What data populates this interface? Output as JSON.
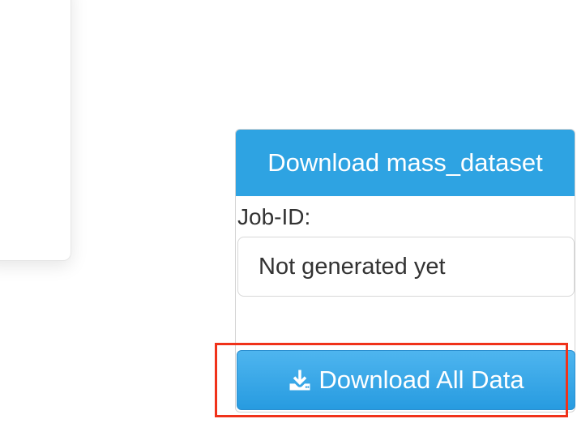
{
  "panel": {
    "title": "Download mass_dataset",
    "job_label": "Job-ID:",
    "job_value": "Not generated yet",
    "download_label": "Download All Data"
  },
  "icons": {
    "download": "download-icon"
  },
  "colors": {
    "header": "#2ea3e2",
    "button": "#279be0",
    "highlight": "#f0321a"
  }
}
